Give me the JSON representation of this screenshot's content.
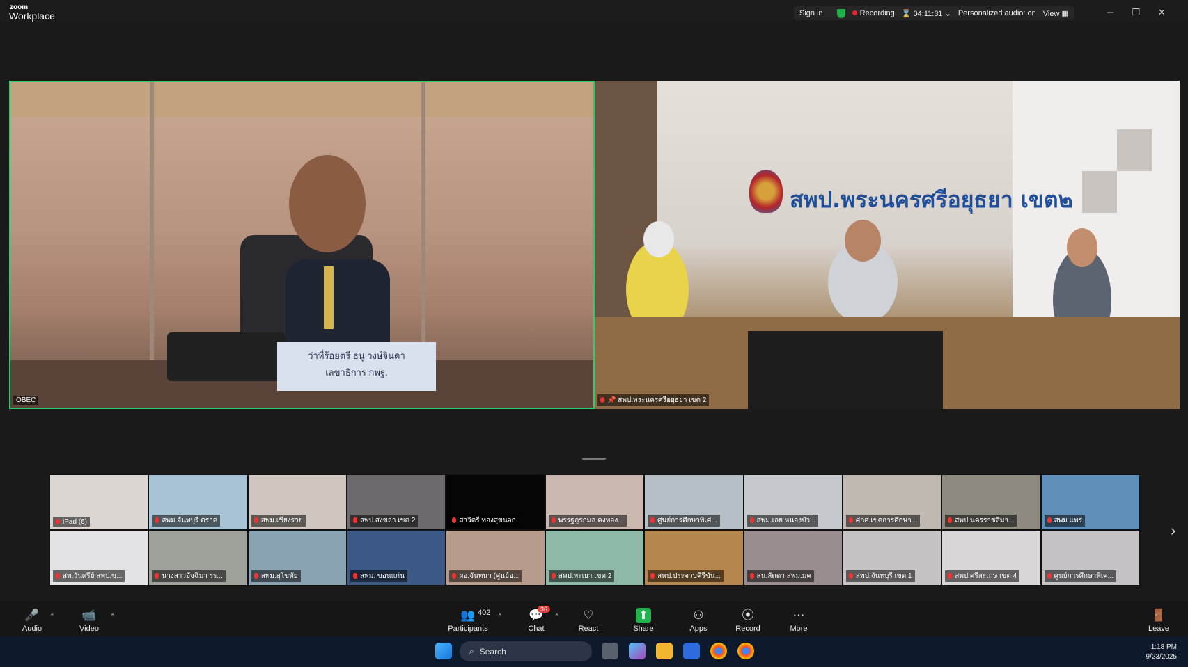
{
  "app": {
    "brand_small": "zoom",
    "brand_big": "Workplace"
  },
  "titlebar": {
    "sign_in": "Sign in",
    "recording": "Recording",
    "timer": "04:11:31",
    "audio_status": "Personalized audio: on",
    "view": "View"
  },
  "main_video": {
    "name": "OBEC",
    "placard_line1": "ว่าที่ร้อยตรี ธนู วงษ์จินดา",
    "placard_line2": "เลขาธิการ กพฐ."
  },
  "second_video": {
    "name": "สพป.พระนครศรีอยุธยา เขต 2",
    "sign_text": "สพป.พระนครศรีอยุธยา เขต๒"
  },
  "gallery": [
    {
      "name": "iPad (6)",
      "bg": "#dcd6d2"
    },
    {
      "name": "สพม.จันทบุรี ตราด",
      "bg": "#a9c3d6"
    },
    {
      "name": "สพม.เชียงราย",
      "bg": "#cfc7bf"
    },
    {
      "name": "สพป.สงขลา เขต 2",
      "bg": "#6e6a6e"
    },
    {
      "name": "สาวิตรี ทองสุขนอก",
      "bg": "#050505"
    },
    {
      "name": "พรรฐภูรกมล คงทอง...",
      "bg": "#c9b7b0"
    },
    {
      "name": "ศูนย์การศึกษาพิเศ...",
      "bg": "#b7bfc6"
    },
    {
      "name": "สพม.เลย หนองบัว...",
      "bg": "#c5c8cd"
    },
    {
      "name": "ศกศ.เขตการศึกษา...",
      "bg": "#bfb9b2"
    },
    {
      "name": "สพป.นครราชสีมา...",
      "bg": "#8f8a7f"
    },
    {
      "name": "สพม.แพร่",
      "bg": "#5f8fb8"
    },
    {
      "name": "สพ.วันศรีย์ สพป.ข...",
      "bg": "#e3e3e5"
    },
    {
      "name": "นางสาวอัจฉิมา รร...",
      "bg": "#9fa29b"
    },
    {
      "name": "สพม.สุโขทัย",
      "bg": "#8aa3b3"
    },
    {
      "name": "สพม. ขอนแก่น",
      "bg": "#3d5a86"
    },
    {
      "name": "ผอ.จันทนา (ศูนย์อ...",
      "bg": "#b79c8c"
    },
    {
      "name": "สพป.พะเยา เขต 2",
      "bg": "#8fb9a7"
    },
    {
      "name": "สพป.ประจวบคีรีขัน...",
      "bg": "#b5874e"
    },
    {
      "name": "สน.ลัดดา สพม.มค",
      "bg": "#9a8d8f"
    },
    {
      "name": "สพป.จันทบุรี เขต 1",
      "bg": "#c7c3c5"
    },
    {
      "name": "สพป.ศรีสะเกษ เขต 4",
      "bg": "#d9d6d8"
    },
    {
      "name": "ศูนย์การศึกษาพิเศ...",
      "bg": "#c4c2c5"
    }
  ],
  "toolbar": {
    "audio": "Audio",
    "video": "Video",
    "participants": "Participants",
    "participants_count": "402",
    "chat": "Chat",
    "chat_badge": "36",
    "react": "React",
    "share": "Share",
    "apps": "Apps",
    "record": "Record",
    "more": "More",
    "leave": "Leave"
  },
  "taskbar": {
    "search": "Search",
    "time": "1:18 PM",
    "date": "9/23/2025"
  },
  "colors": {
    "active_speaker": "#2ecc71",
    "share_green": "#22b14c",
    "leave_red": "#e53935",
    "recording_red": "#e02828"
  }
}
